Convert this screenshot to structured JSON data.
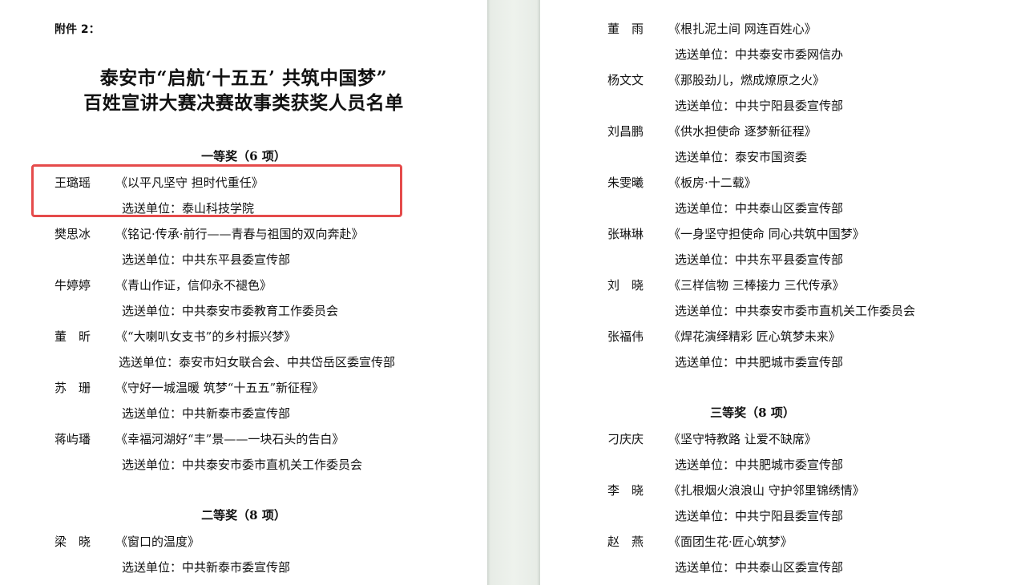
{
  "left_page": {
    "attachment": "附件 2：",
    "title_line1": "泰安市“启航‘十五五’ 共筑中国梦”",
    "title_line2": "百姓宣讲大赛决赛故事类获奖人员名单",
    "first_prize": {
      "heading": "一等奖（6 项）",
      "entries": [
        {
          "name": "王璐瑶",
          "story": "《以平凡坚守 担时代重任》",
          "unit": "选送单位：泰山科技学院"
        },
        {
          "name": "樊思冰",
          "story": "《铭记·传承·前行——青春与祖国的双向奔赴》",
          "unit": "选送单位：中共东平县委宣传部"
        },
        {
          "name": "牛婷婷",
          "story": "《青山作证，信仰永不褪色》",
          "unit": "选送单位：中共泰安市委教育工作委员会"
        },
        {
          "name": "董　昕",
          "story": "《“大喇叭女支书”的乡村振兴梦》",
          "unit": "选送单位：泰安市妇女联合会、中共岱岳区委宣传部"
        },
        {
          "name": "苏　珊",
          "story": "《守好一城温暖 筑梦“十五五”新征程》",
          "unit": "选送单位：中共新泰市委宣传部"
        },
        {
          "name": "蒋屿璠",
          "story": "《幸福河湖好“丰”景——一块石头的告白》",
          "unit": "选送单位：中共泰安市委市直机关工作委员会"
        }
      ]
    },
    "second_prize": {
      "heading": "二等奖（8 项）",
      "entries": [
        {
          "name": "梁　晓",
          "story": "《窗口的温度》",
          "unit": "选送单位：中共新泰市委宣传部"
        }
      ]
    }
  },
  "right_page": {
    "second_prize_cont": [
      {
        "name": "董　雨",
        "story": "《根扎泥土间 网连百姓心》",
        "unit": "选送单位：中共泰安市委网信办"
      },
      {
        "name": "杨文文",
        "story": "《那股劲儿，燃成燎原之火》",
        "unit": "选送单位：中共宁阳县委宣传部"
      },
      {
        "name": "刘昌鹏",
        "story": "《供水担使命 逐梦新征程》",
        "unit": "选送单位：泰安市国资委"
      },
      {
        "name": "朱雯曦",
        "story": "《板房·十二载》",
        "unit": "选送单位：中共泰山区委宣传部"
      },
      {
        "name": "张琳琳",
        "story": "《一身坚守担使命 同心共筑中国梦》",
        "unit": "选送单位：中共东平县委宣传部"
      },
      {
        "name": "刘　晓",
        "story": "《三样信物 三棒接力 三代传承》",
        "unit": "选送单位：中共泰安市委市直机关工作委员会"
      },
      {
        "name": "张福伟",
        "story": "《焊花演绎精彩 匠心筑梦未来》",
        "unit": "选送单位：中共肥城市委宣传部"
      }
    ],
    "third_prize": {
      "heading": "三等奖（8 项）",
      "entries": [
        {
          "name": "刁庆庆",
          "story": "《坚守特教路 让爱不缺席》",
          "unit": "选送单位：中共肥城市委宣传部"
        },
        {
          "name": "李　晓",
          "story": "《扎根烟火浪浪山 守护邻里锦绣情》",
          "unit": "选送单位：中共宁阳县委宣传部"
        },
        {
          "name": "赵　燕",
          "story": "《面团生花·匠心筑梦》",
          "unit": "选送单位：中共泰山区委宣传部"
        }
      ]
    }
  },
  "highlight_color": "#e54b4b"
}
